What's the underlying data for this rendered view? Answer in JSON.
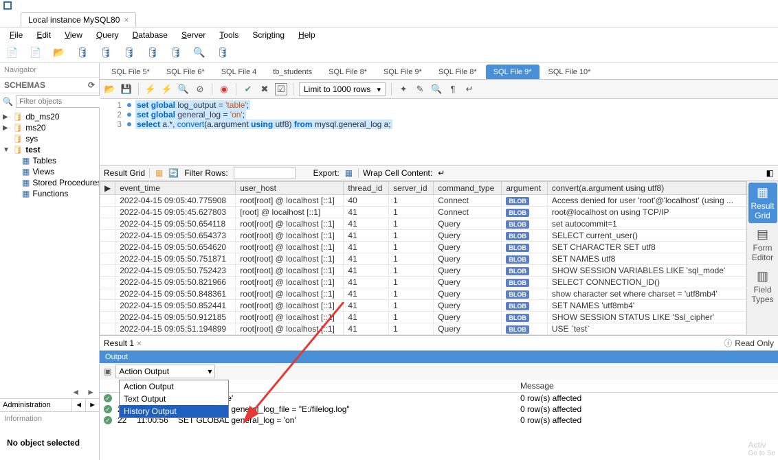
{
  "tab": {
    "title": "Local instance MySQL80"
  },
  "menu": {
    "file": "File",
    "edit": "Edit",
    "view": "View",
    "query": "Query",
    "database": "Database",
    "server": "Server",
    "tools": "Tools",
    "scripting": "Scripting",
    "help": "Help"
  },
  "nav": {
    "header": "Navigator",
    "schemas_label": "SCHEMAS",
    "filter_placeholder": "Filter objects",
    "tree": {
      "db_ms20": "db_ms20",
      "ms20": "ms20",
      "sys": "sys",
      "test": "test",
      "tables": "Tables",
      "views": "Views",
      "stored": "Stored Procedures",
      "functions": "Functions"
    },
    "admin_tab": "Administration",
    "info_header": "Information",
    "no_object": "No object selected"
  },
  "file_tabs": [
    "SQL File 5*",
    "SQL File 6*",
    "SQL File 4",
    "tb_students",
    "SQL File 8*",
    "SQL File 9*",
    "SQL File 8*",
    "SQL File 9*",
    "SQL File 10*"
  ],
  "active_file_tab": 7,
  "editor": {
    "limit": "Limit to 1000 rows",
    "lines": [
      {
        "n": "1",
        "html": "<span class='kw'>set</span> <span class='kw'>global</span> <span class='id'>log_output</span> <span class='pun'>=</span> <span class='str'>'table'</span><span class='pun'>;</span>"
      },
      {
        "n": "2",
        "html": "<span class='kw'>set</span> <span class='kw'>global</span> <span class='id'>general_log</span> <span class='pun'>=</span> <span class='str'>'on'</span><span class='pun'>;</span>"
      },
      {
        "n": "3",
        "html": "<span class='kw'>select</span> <span class='id'>a</span><span class='pun'>.*,</span> <span class='kw2'>convert</span><span class='pun'>(</span><span class='id'>a.argument</span> <span class='kw'>using</span> <span class='id'>utf8</span><span class='pun'>)</span> <span class='kw'>from</span> <span class='id'>mysql.general_log a</span><span class='pun'>;</span>"
      }
    ]
  },
  "result": {
    "grid_label": "Result Grid",
    "filter_label": "Filter Rows:",
    "export_label": "Export:",
    "wrap_label": "Wrap Cell Content:",
    "columns": [
      "event_time",
      "user_host",
      "thread_id",
      "server_id",
      "command_type",
      "argument",
      "convert(a.argument using utf8)"
    ],
    "rows": [
      [
        "2022-04-15 09:05:40.775908",
        "root[root] @ localhost [::1]",
        "40",
        "1",
        "Connect",
        "BLOB",
        "Access denied for user 'root'@'localhost' (using ..."
      ],
      [
        "2022-04-15 09:05:45.627803",
        "[root] @ localhost [::1]",
        "41",
        "1",
        "Connect",
        "BLOB",
        "root@localhost on  using TCP/IP"
      ],
      [
        "2022-04-15 09:05:50.654118",
        "root[root] @ localhost [::1]",
        "41",
        "1",
        "Query",
        "BLOB",
        "set autocommit=1"
      ],
      [
        "2022-04-15 09:05:50.654373",
        "root[root] @ localhost [::1]",
        "41",
        "1",
        "Query",
        "BLOB",
        "SELECT current_user()"
      ],
      [
        "2022-04-15 09:05:50.654620",
        "root[root] @ localhost [::1]",
        "41",
        "1",
        "Query",
        "BLOB",
        "SET CHARACTER SET utf8"
      ],
      [
        "2022-04-15 09:05:50.751871",
        "root[root] @ localhost [::1]",
        "41",
        "1",
        "Query",
        "BLOB",
        "SET NAMES utf8"
      ],
      [
        "2022-04-15 09:05:50.752423",
        "root[root] @ localhost [::1]",
        "41",
        "1",
        "Query",
        "BLOB",
        "SHOW SESSION VARIABLES LIKE 'sql_mode'"
      ],
      [
        "2022-04-15 09:05:50.821966",
        "root[root] @ localhost [::1]",
        "41",
        "1",
        "Query",
        "BLOB",
        "SELECT CONNECTION_ID()"
      ],
      [
        "2022-04-15 09:05:50.848361",
        "root[root] @ localhost [::1]",
        "41",
        "1",
        "Query",
        "BLOB",
        "show character set where charset = 'utf8mb4'"
      ],
      [
        "2022-04-15 09:05:50.852441",
        "root[root] @ localhost [::1]",
        "41",
        "1",
        "Query",
        "BLOB",
        "SET NAMES 'utf8mb4'"
      ],
      [
        "2022-04-15 09:05:50.912185",
        "root[root] @ localhost [::1]",
        "41",
        "1",
        "Query",
        "BLOB",
        "SHOW SESSION STATUS LIKE 'Ssl_cipher'"
      ],
      [
        "2022-04-15 09:05:51.194899",
        "root[root] @ localhost [::1]",
        "41",
        "1",
        "Query",
        "BLOB",
        "USE `test`"
      ]
    ],
    "result_tab": "Result 1",
    "readonly": "Read Only",
    "side": {
      "grid": "Result Grid",
      "form": "Form Editor",
      "types": "Field Types"
    }
  },
  "output": {
    "header": "Output",
    "selected": "Action Output",
    "options": [
      "Action Output",
      "Text Output",
      "History Output"
    ],
    "col_msg": "Message",
    "rows": [
      {
        "idx": "",
        "time": "",
        "action": "g_output = 'file'",
        "msg": "0 row(s) affected"
      },
      {
        "idx": "21",
        "time": "11:00:56",
        "action": "SET GLOBAL general_log_file = \"E:/filelog.log\"",
        "msg": "0 row(s) affected"
      },
      {
        "idx": "22",
        "time": "11:00:56",
        "action": "SET GLOBAL general_log = 'on'",
        "msg": "0 row(s) affected"
      }
    ]
  },
  "watermark": {
    "t1": "Activ",
    "t2": "Go to Se"
  }
}
